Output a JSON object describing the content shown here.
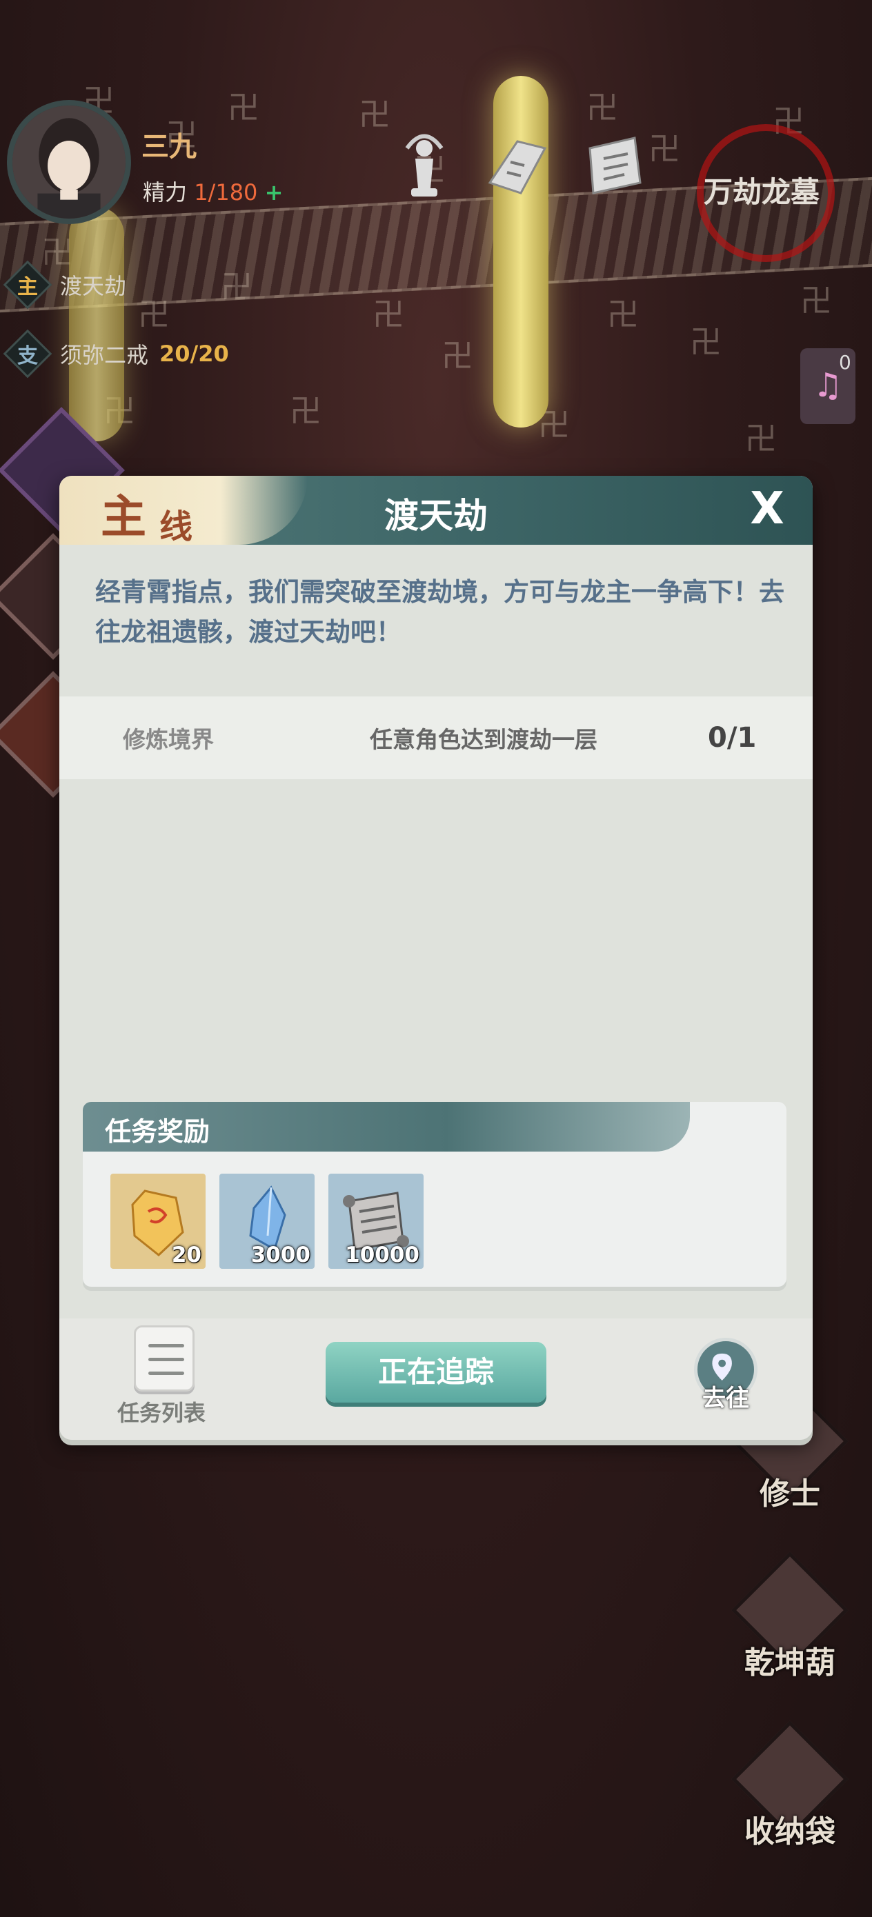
{
  "player": {
    "name": "三九",
    "energy_label": "精力",
    "energy_value": "1/180",
    "energy_plus": "+"
  },
  "location": "万劫龙墓",
  "quest_tracker": [
    {
      "tag": "主",
      "tag_color": "#e8b34a",
      "title": "渡天劫",
      "count": ""
    },
    {
      "tag": "支",
      "tag_color": "#8fb3c9",
      "title": "须弥二戒",
      "count": "20/20"
    }
  ],
  "music_widget": {
    "count": "0"
  },
  "right_menu": [
    {
      "label": "修士"
    },
    {
      "label": "乾坤葫"
    },
    {
      "label": "收纳袋"
    }
  ],
  "modal": {
    "badge_big": "主",
    "badge_small": "线",
    "title": "渡天劫",
    "close": "X",
    "description": "经青霄指点，我们需突破至渡劫境，方可与龙主一争高下！去往龙祖遗骸，渡过天劫吧！",
    "requirement": {
      "category": "修炼境界",
      "condition": "任意角色达到渡劫一层",
      "progress": "0/1"
    },
    "rewards_title": "任务奖励",
    "rewards": [
      {
        "icon": "amber-crystal-icon",
        "qty": "20"
      },
      {
        "icon": "blue-crystal-icon",
        "qty": "3000"
      },
      {
        "icon": "scroll-icon",
        "qty": "10000"
      }
    ],
    "footer": {
      "list_label": "任务列表",
      "track_label": "正在追踪",
      "go_label": "去往"
    }
  },
  "colors": {
    "accent_teal": "#3c6465",
    "track_button": "#5aa8a0",
    "energy_value": "#ef6a3c",
    "energy_plus": "#39c46c",
    "count_gold": "#e8b34a"
  }
}
